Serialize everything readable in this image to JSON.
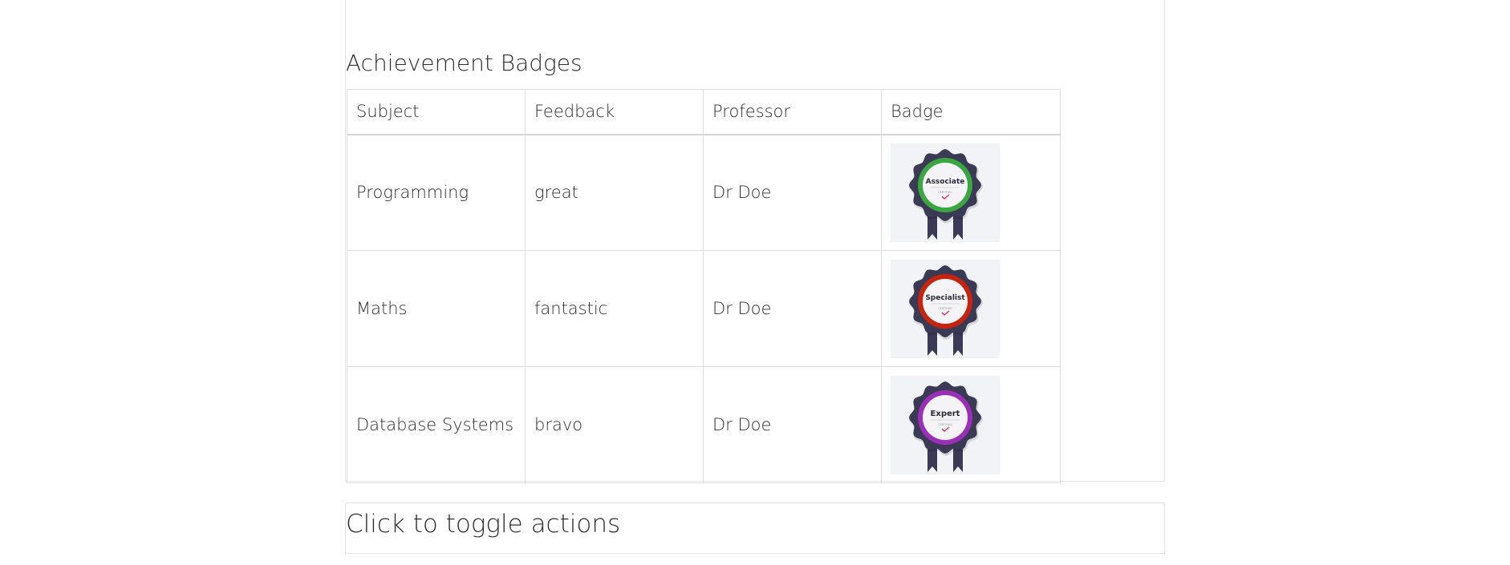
{
  "section": {
    "title": "Achievement Badges"
  },
  "table": {
    "headers": [
      "Subject",
      "Feedback",
      "Professor",
      "Badge"
    ],
    "rows": [
      {
        "subject": "Programming",
        "feedback": "great",
        "professor": "Dr Doe",
        "badge": {
          "label": "Associate",
          "sub": "CERTIFIED",
          "ring_color": "#3aa640"
        }
      },
      {
        "subject": "Maths",
        "feedback": "fantastic",
        "professor": "Dr Doe",
        "badge": {
          "label": "Specialist",
          "sub": "CERTIFIED",
          "ring_color": "#c8230f"
        }
      },
      {
        "subject": "Database Systems",
        "feedback": "bravo",
        "professor": "Dr Doe",
        "badge": {
          "label": "Expert",
          "sub": "CERTIFIED",
          "ring_color": "#9b2fb8"
        }
      }
    ]
  },
  "toggle": {
    "label": "Click to toggle actions"
  },
  "colors": {
    "badge_body": "#3b3a55",
    "badge_bg": "#f1f3f6",
    "check": "#d6336c"
  }
}
